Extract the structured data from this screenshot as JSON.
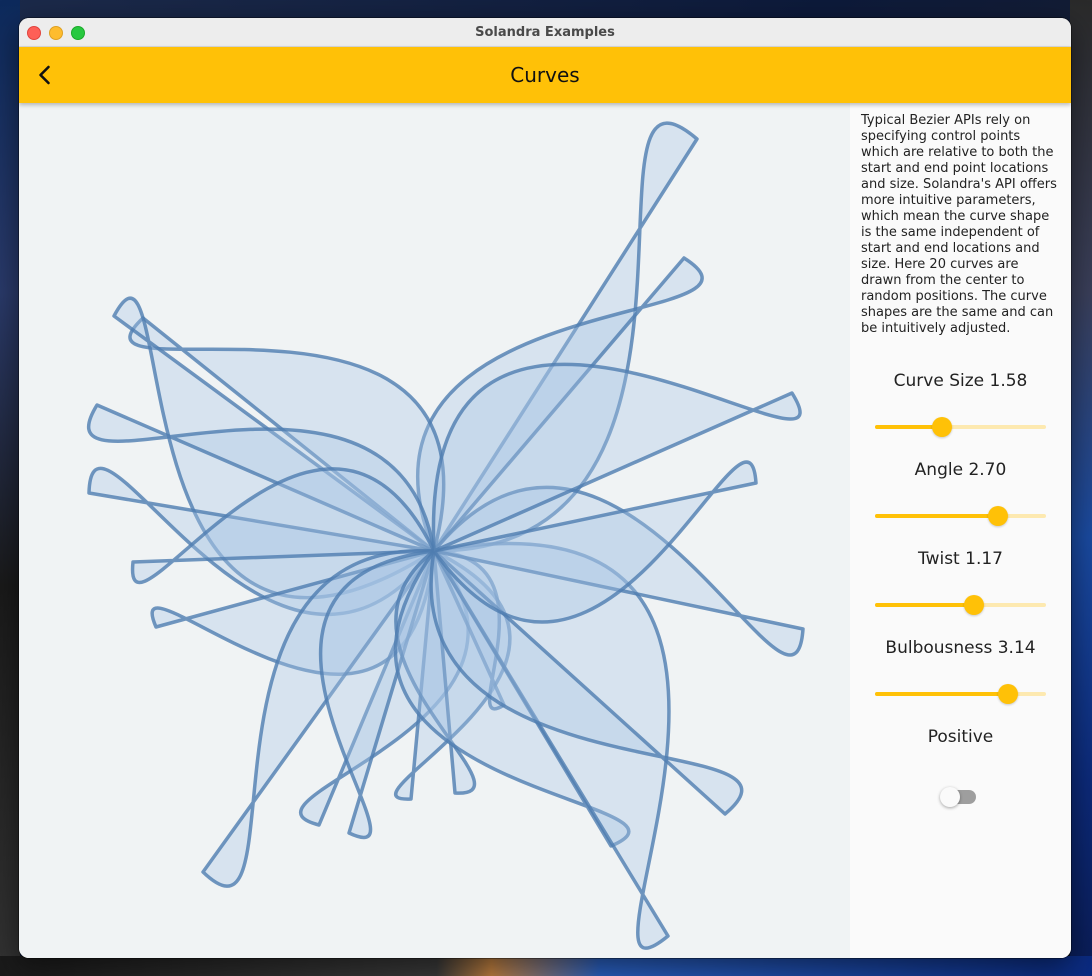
{
  "window": {
    "title": "Solandra Examples"
  },
  "appbar": {
    "title": "Curves",
    "back_icon": "arrow-back-icon"
  },
  "description": "Typical Bezier APIs rely on specifying control points which are relative to both the start and end point locations and size. Solandra's API offers more intuitive parameters, which mean the curve shape is the same independent of start and end locations and size. Here 20 curves are drawn from the center to random positions. The curve shapes are the same and can be intuitively adjusted.",
  "controls": {
    "curve_size": {
      "label": "Curve Size 1.58",
      "fraction": 0.39
    },
    "angle": {
      "label": "Angle 2.70",
      "fraction": 0.72
    },
    "twist": {
      "label": "Twist 1.17",
      "fraction": 0.58
    },
    "bulbousness": {
      "label": "Bulbousness 3.14",
      "fraction": 0.78
    },
    "positive": {
      "label": "Positive",
      "value": false
    }
  },
  "colors": {
    "accent": "#ffc107",
    "curve_stroke": "#4f7db0",
    "curve_fill": "#a9c6e6",
    "canvas_bg": "#f0f3f4"
  }
}
